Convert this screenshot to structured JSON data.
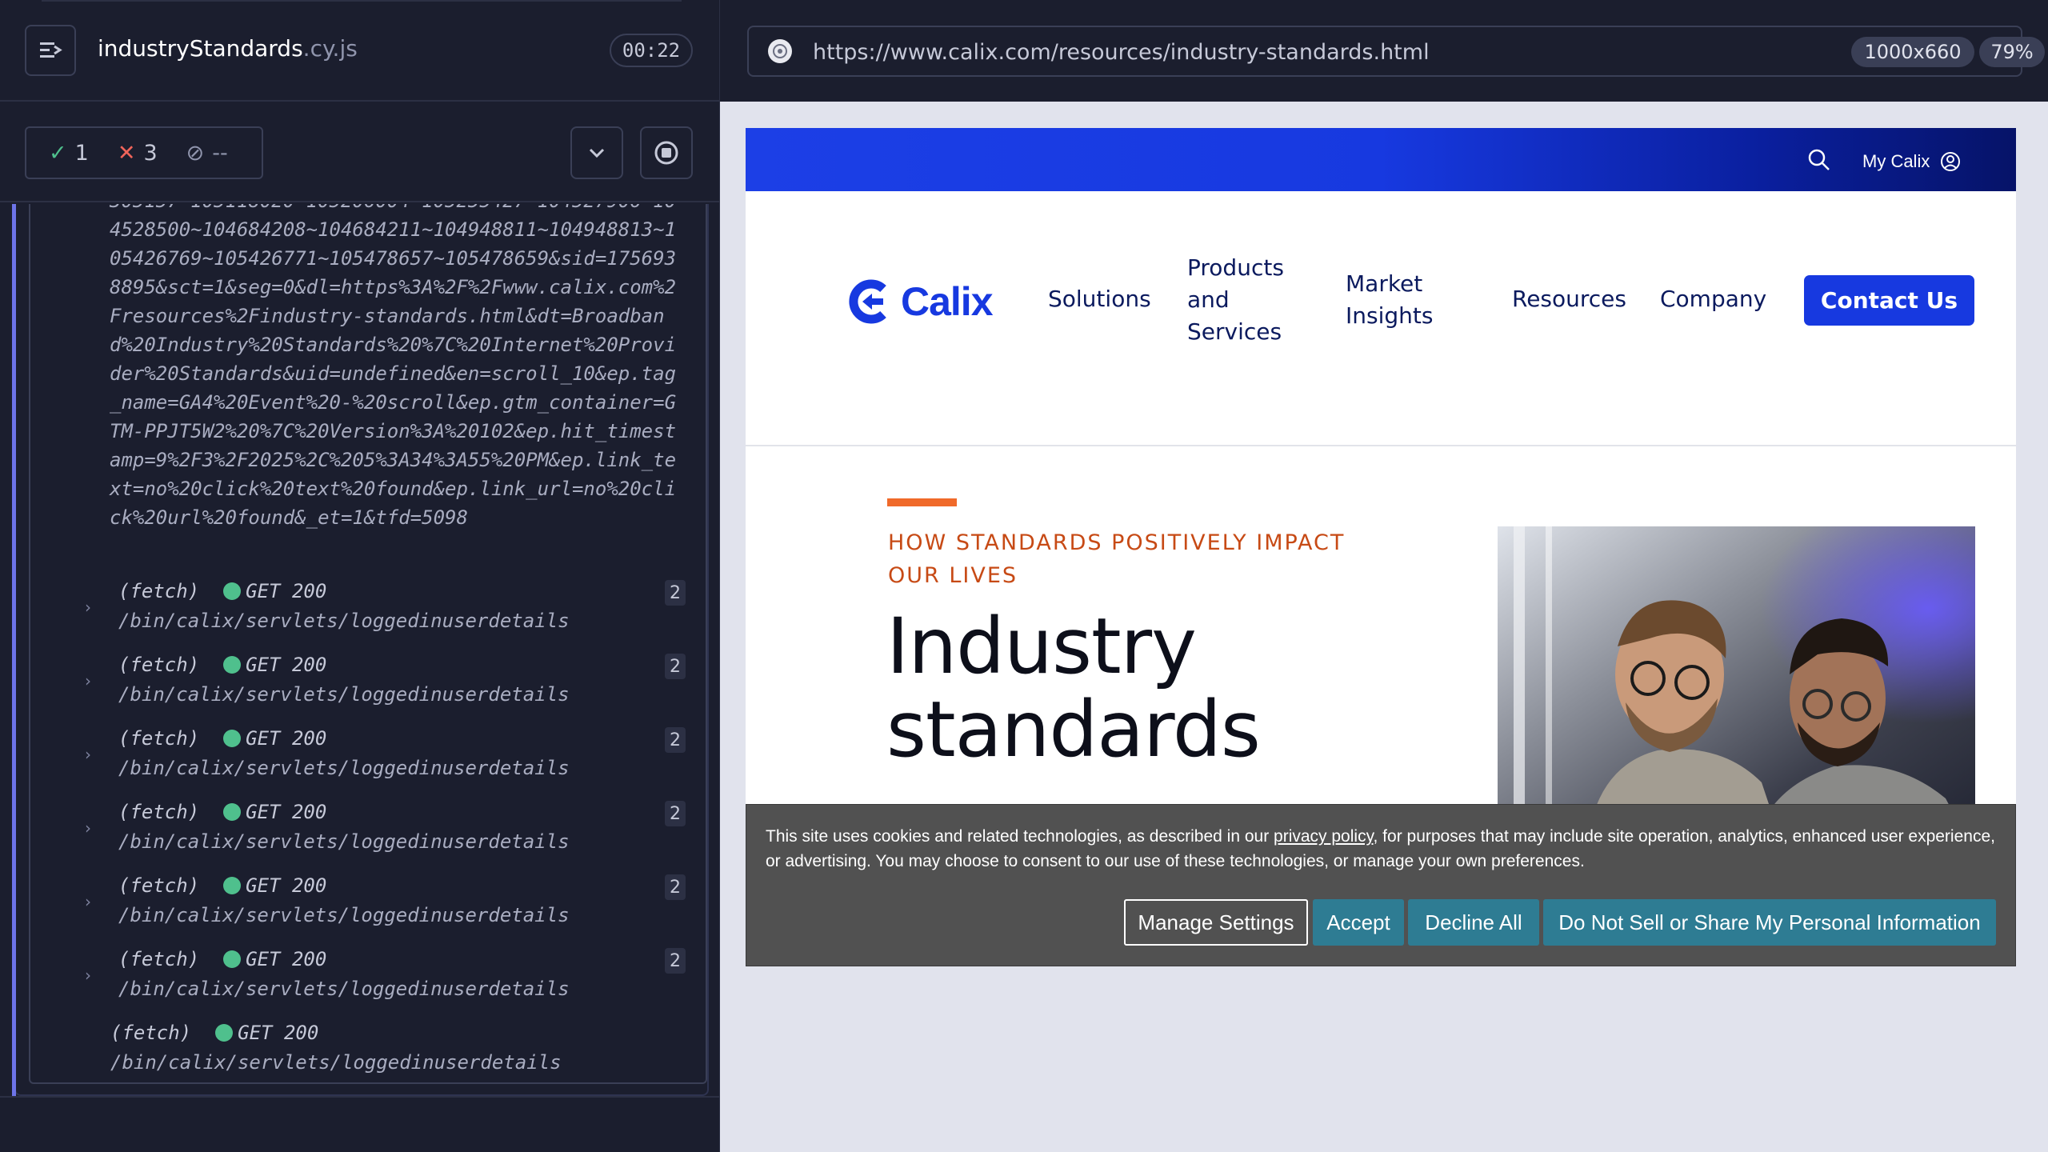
{
  "runner": {
    "spec_name": "industryStandards",
    "spec_ext": ".cy.js",
    "timer": "00:22",
    "stats": {
      "passed": "1",
      "failed": "3",
      "pending": "--"
    }
  },
  "log": {
    "url_text": "305157~105118020~105206004~105255427~104527906~104528500~104684208~104684211~104948811~104948813~105426769~105426771~105478657~105478659&sid=1756938895&sct=1&seg=0&dl=https%3A%2F%2Fwww.calix.com%2Fresources%2Findustry-standards.html&dt=Broadband%20Industry%20Standards%20%7C%20Internet%20Provider%20Standards&uid=undefined&en=scroll_10&ep.tag_name=GA4%20Event%20-%20scroll&ep.gtm_container=GTM-PPJT5W2%20%7C%20Version%3A%20102&ep.hit_timestamp=9%2F3%2F2025%2C%205%3A34%3A55%20PM&ep.link_text=no%20click%20text%20found&ep.link_url=no%20click%20url%20found&_et=1&tfd=5098",
    "commands": [
      {
        "type": "(fetch)",
        "method": "GET 200",
        "path": "/bin/calix/servlets/loggedinuserdetails",
        "count": "2"
      },
      {
        "type": "(fetch)",
        "method": "GET 200",
        "path": "/bin/calix/servlets/loggedinuserdetails",
        "count": "2"
      },
      {
        "type": "(fetch)",
        "method": "GET 200",
        "path": "/bin/calix/servlets/loggedinuserdetails",
        "count": "2"
      },
      {
        "type": "(fetch)",
        "method": "GET 200",
        "path": "/bin/calix/servlets/loggedinuserdetails",
        "count": "2"
      },
      {
        "type": "(fetch)",
        "method": "GET 200",
        "path": "/bin/calix/servlets/loggedinuserdetails",
        "count": "2"
      },
      {
        "type": "(fetch)",
        "method": "GET 200",
        "path": "/bin/calix/servlets/loggedinuserdetails",
        "count": "2"
      },
      {
        "type": "(fetch)",
        "method": "GET 200",
        "path": "/bin/calix/servlets/loggedinuserdetails",
        "count": ""
      }
    ]
  },
  "browser": {
    "url": "https://www.calix.com/resources/industry-standards.html",
    "viewport": "1000x660",
    "zoom": "79%"
  },
  "site": {
    "my_calix": "My Calix",
    "logo": "Calix",
    "nav": {
      "solutions": "Solutions",
      "products_1": "Products",
      "products_2": "and",
      "products_3": "Services",
      "market_1": "Market",
      "market_2": "Insights",
      "resources": "Resources",
      "company": "Company"
    },
    "contact": "Contact Us",
    "eyebrow": "HOW STANDARDS POSITIVELY IMPACT OUR LIVES",
    "hero_line1": "Industry",
    "hero_line2": "standards"
  },
  "cookie": {
    "text_before": "This site uses cookies and related technologies, as described in our ",
    "link": "privacy policy",
    "text_after": ", for purposes that may include site operation, analytics, enhanced user experience, or advertising. You may choose to consent to our use of these technologies, or manage your own preferences.",
    "manage": "Manage Settings",
    "accept": "Accept",
    "decline": "Decline All",
    "dnss": "Do Not Sell or Share My Personal Information"
  },
  "colors": {
    "runner_bg": "#1b1e2e",
    "pass": "#4fc08d",
    "fail": "#f0645a",
    "calix_blue": "#1739e0",
    "accent_orange": "#f06a2a",
    "cookie_bg": "#515151",
    "cookie_btn": "#2e7c93"
  }
}
